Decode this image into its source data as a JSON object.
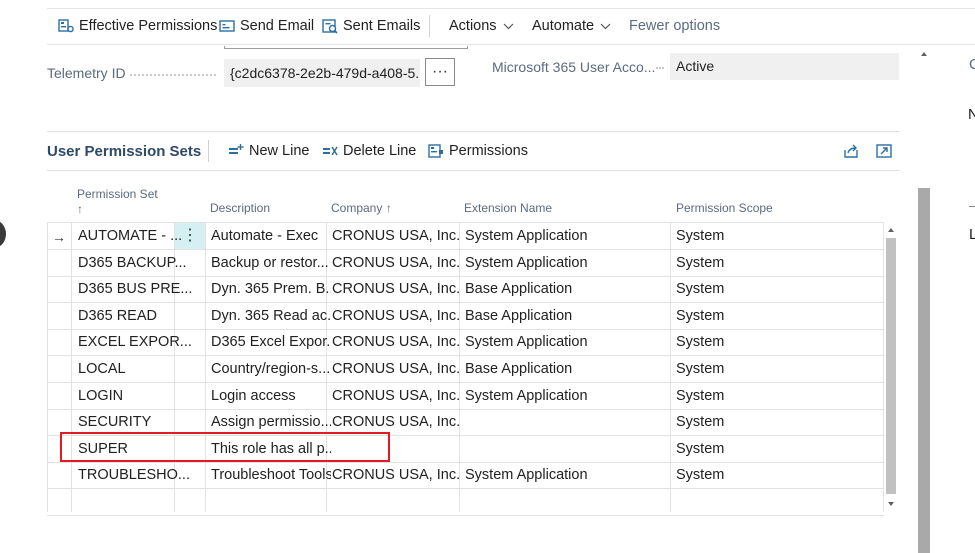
{
  "action_bar": {
    "effective_permissions": "Effective Permissions",
    "send_email": "Send Email",
    "sent_emails": "Sent Emails",
    "actions": "Actions",
    "automate": "Automate",
    "fewer_options": "Fewer options"
  },
  "fields": {
    "telemetry_label": "Telemetry ID",
    "telemetry_value": "{c2dc6378-2e2b-479d-a408-5...",
    "ellipsis": "···",
    "m365_label": "Microsoft 365 User Acco...",
    "m365_value": "Active"
  },
  "subpage": {
    "title": "User Permission Sets",
    "new_line": "New Line",
    "delete_line": "Delete Line",
    "permissions": "Permissions"
  },
  "table": {
    "headers": {
      "permission_set": "Permission Set",
      "sort_arrow": "↑",
      "description": "Description",
      "company": "Company ↑",
      "extension_name": "Extension Name",
      "permission_scope": "Permission Scope"
    },
    "row_menu": "⋮",
    "current_row_arrow": "→",
    "rows": [
      {
        "permission_set": "AUTOMATE - ...",
        "description": "Automate - Exec",
        "company": "CRONUS USA, Inc.",
        "extension": "System Application",
        "scope": "System"
      },
      {
        "permission_set": "D365 BACKUP...",
        "description": "Backup or restor...",
        "company": "CRONUS USA, Inc.",
        "extension": "System Application",
        "scope": "System"
      },
      {
        "permission_set": "D365 BUS PRE...",
        "description": "Dyn. 365 Prem. B...",
        "company": "CRONUS USA, Inc.",
        "extension": "Base Application",
        "scope": "System"
      },
      {
        "permission_set": "D365 READ",
        "description": "Dyn. 365 Read ac...",
        "company": "CRONUS USA, Inc.",
        "extension": "Base Application",
        "scope": "System"
      },
      {
        "permission_set": "EXCEL EXPOR...",
        "description": "D365 Excel Expor...",
        "company": "CRONUS USA, Inc.",
        "extension": "System Application",
        "scope": "System"
      },
      {
        "permission_set": "LOCAL",
        "description": "Country/region-s...",
        "company": "CRONUS USA, Inc.",
        "extension": "Base Application",
        "scope": "System"
      },
      {
        "permission_set": "LOGIN",
        "description": "Login access",
        "company": "CRONUS USA, Inc.",
        "extension": "System Application",
        "scope": "System"
      },
      {
        "permission_set": "SECURITY",
        "description": "Assign permissio...",
        "company": "CRONUS USA, Inc.",
        "extension": "",
        "scope": "System"
      },
      {
        "permission_set": "SUPER",
        "description": "This role has all p...",
        "company": "",
        "extension": "",
        "scope": "System"
      },
      {
        "permission_set": "TROUBLESHO...",
        "description": "Troubleshoot Tools",
        "company": "CRONUS USA, Inc.",
        "extension": "System Application",
        "scope": "System"
      }
    ]
  },
  "right_pane": {
    "label_c": "C",
    "label_n": "N",
    "label_l": "L"
  },
  "colors": {
    "highlight_box": "#e01b24",
    "selected_cell": "#d4f0f2",
    "subtitle": "#2e4a6b",
    "icon_blue": "#2d6fa3"
  }
}
